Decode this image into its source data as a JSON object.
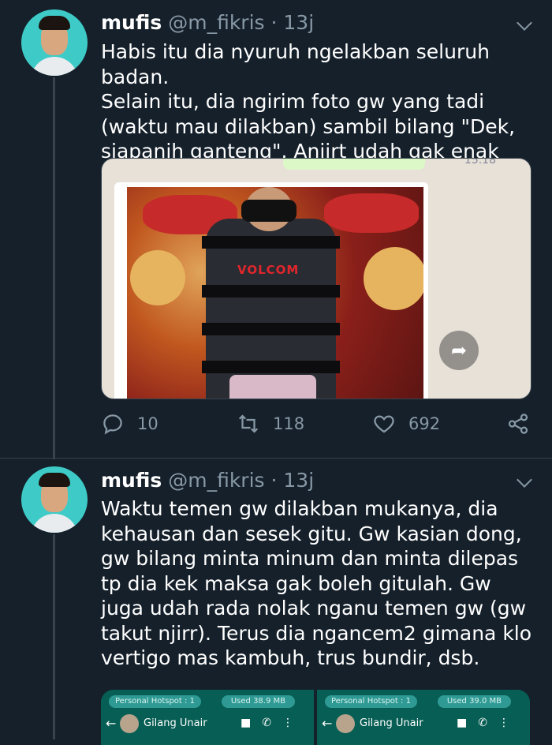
{
  "tweets": [
    {
      "author": {
        "name": "mufis",
        "handle": "@m_fikris",
        "time": "· 13j"
      },
      "text": "Habis itu dia nyuruh ngelakban seluruh badan.\nSelain itu, dia ngirim foto gw yang tadi (waktu mau dilakban) sambil bilang \"Dek, siapanih ganteng\". Anjirt udah gak enak bgt gw.",
      "media": {
        "bubble_time": "15.18",
        "photo_logo": "VOLCOM"
      },
      "actions": {
        "replies": "10",
        "retweets": "118",
        "likes": "692"
      }
    },
    {
      "author": {
        "name": "mufis",
        "handle": "@m_fikris",
        "time": "· 13j"
      },
      "text": "Waktu temen gw dilakban mukanya, dia kehausan dan sesek gitu. Gw kasian dong, gw bilang minta minum dan minta dilepas tp dia kek maksa gak boleh gitulah. Gw juga udah rada nolak nganu temen gw (gw takut njirr). Terus dia ngancem2 gimana klo vertigo mas kambuh, trus bundir, dsb."
    }
  ],
  "screenshots": [
    {
      "hotspot": "Personal Hotspot : 1",
      "used": "Used  38.9 MB",
      "contact": "Gilang Unair"
    },
    {
      "hotspot": "Personal Hotspot : 1",
      "used": "Used  39.0 MB",
      "contact": "Gilang Unair"
    }
  ],
  "colors": {
    "background": "#15202b",
    "secondary_text": "#8899a6",
    "divider": "#38444d"
  }
}
